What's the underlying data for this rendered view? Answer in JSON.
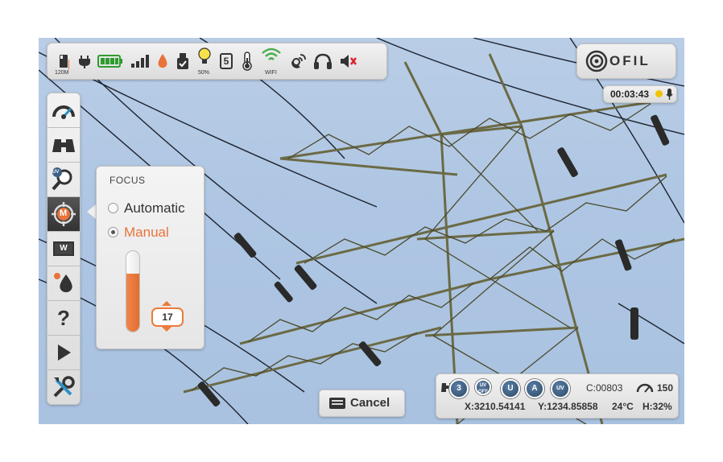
{
  "status_bar": {
    "storage_label": "120M",
    "brightness_label": "50%",
    "preset_number": "5",
    "wifi_label": "WIFI",
    "icons": [
      "sd-card-icon",
      "plug-icon",
      "battery-icon",
      "signal-icon",
      "drop-icon",
      "usb-icon",
      "bulb-icon",
      "preset-icon",
      "thermometer-icon",
      "wifi-icon",
      "gps-icon",
      "headphones-icon",
      "mute-icon"
    ]
  },
  "logo": {
    "text": "OFIL"
  },
  "timer": {
    "time": "00:03:43"
  },
  "toolbar": {
    "items": [
      "gauge-icon",
      "binoculars-icon",
      "uv-zoom-icon",
      "focus-manual-icon",
      "white-balance-icon",
      "drop-icon",
      "help-icon",
      "play-icon",
      "tools-icon"
    ],
    "wb_label": "W",
    "focus_badge": "M",
    "uv_badge": "UV",
    "help_glyph": "?"
  },
  "focus_popup": {
    "title": "FOCUS",
    "options": [
      {
        "label": "Automatic",
        "selected": false
      },
      {
        "label": "Manual",
        "selected": true
      }
    ],
    "value": "17",
    "level": 0.72
  },
  "cancel": {
    "label": "Cancel"
  },
  "info_panel": {
    "modes": [
      "3",
      "UV OFF",
      "U",
      "A",
      "UV"
    ],
    "counter": "C:00803",
    "gain": "150",
    "x_coord": "X:3210.54141",
    "y_coord": "Y:1234.85858",
    "temperature": "24°C",
    "humidity": "H:32%"
  },
  "colors": {
    "accent": "#e8733a",
    "panel": "#e6e6e6",
    "wifi": "#4caf50",
    "battery": "#2e9b2e",
    "indicator": "#f2c300"
  }
}
